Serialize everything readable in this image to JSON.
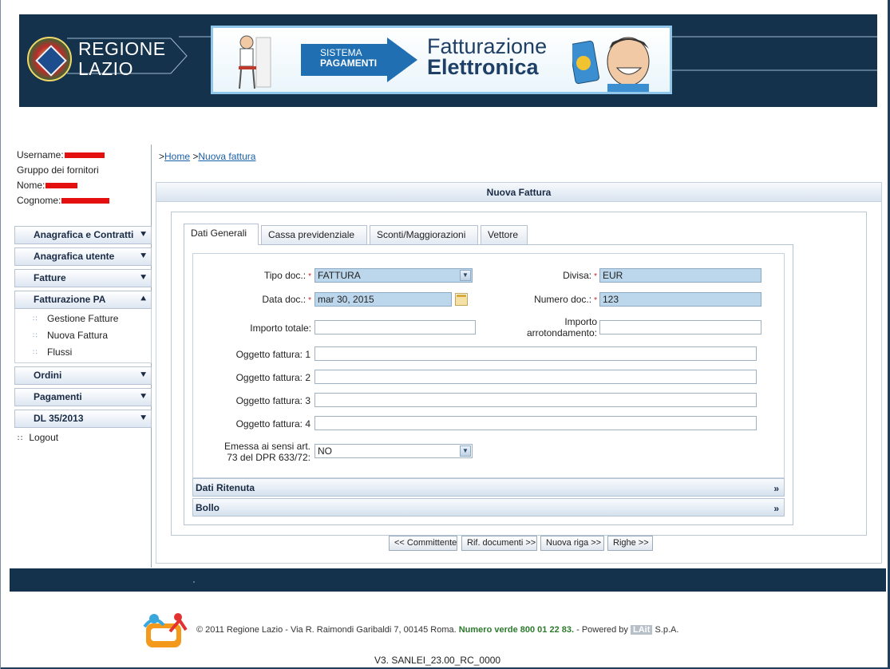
{
  "header": {
    "logo_line1": "REGIONE",
    "logo_line2": "LAZIO",
    "banner_sistema": "SISTEMA",
    "banner_pagamenti": "PAGAMENTI",
    "banner_title1": "Fatturazione",
    "banner_title2": "Elettronica"
  },
  "user": {
    "username_label": "Username:",
    "group": "Gruppo dei fornitori",
    "nome_label": "Nome:",
    "cognome_label": "Cognome:"
  },
  "menu": {
    "items": [
      {
        "label": "Anagrafica e Contratti",
        "icon": "chevron-down-icon"
      },
      {
        "label": "Anagrafica utente",
        "icon": "chevron-down-icon"
      },
      {
        "label": "Fatture",
        "icon": "chevron-down-icon"
      },
      {
        "label": "Fatturazione PA",
        "icon": "chevron-up-icon"
      },
      {
        "label": "Ordini",
        "icon": "chevron-down-icon"
      },
      {
        "label": "Pagamenti",
        "icon": "chevron-down-icon"
      },
      {
        "label": "DL 35/2013",
        "icon": "chevron-down-icon"
      }
    ],
    "sub_items": [
      "Gestione Fatture",
      "Nuova Fattura",
      "Flussi"
    ],
    "logout": "Logout"
  },
  "breadcrumb": {
    "sep1": ">",
    "home": "Home",
    "sep2": ">",
    "current": "Nuova fattura"
  },
  "panel": {
    "title": "Nuova Fattura"
  },
  "tabs": [
    "Dati Generali",
    "Cassa previdenziale",
    "Sconti/Maggiorazioni",
    "Vettore"
  ],
  "form": {
    "tipo_doc_label": "Tipo doc.:",
    "tipo_doc_value": "FATTURA",
    "divisa_label": "Divisa:",
    "divisa_value": "EUR",
    "data_doc_label": "Data doc.:",
    "data_doc_value": "mar 30, 2015",
    "numero_doc_label": "Numero doc.:",
    "numero_doc_value": "123",
    "importo_totale_label": "Importo totale:",
    "importo_totale_value": "",
    "importo_arr_label1": "Importo",
    "importo_arr_label2": "arrotondamento:",
    "importo_arr_value": "",
    "oggetto_labels": [
      "Oggetto fattura: 1",
      "Oggetto fattura: 2",
      "Oggetto fattura: 3",
      "Oggetto fattura: 4"
    ],
    "emessa_label1": "Emessa ai sensi art.",
    "emessa_label2": "73 del DPR 633/72:",
    "emessa_value": "NO",
    "required_mark": "*"
  },
  "sections": [
    {
      "label": "Dati Ritenuta",
      "icon": "»"
    },
    {
      "label": "Bollo",
      "icon": "»"
    }
  ],
  "buttons": {
    "committente": "<< Committente",
    "rif_documenti": "Rif. documenti >>",
    "nuova_riga": "Nuova riga >>",
    "righe": "Righe >>"
  },
  "footer": {
    "copyright": "© 2011 Regione Lazio - Via R. Raimondi Garibaldi 7, 00145 Roma.",
    "numero_verde": "Numero verde 800 01 22 83.",
    "powered": " -  Powered by",
    "lait": "LAit",
    "spa": "S.p.A.",
    "version": "V3. SANLEI_23.00_RC_0000"
  },
  "colors": {
    "header_bg": "#14324c",
    "filled_input": "#bcd7ec",
    "link": "#1a5fa8",
    "required": "#cc2222",
    "numero_verde": "#2d7a2d"
  }
}
